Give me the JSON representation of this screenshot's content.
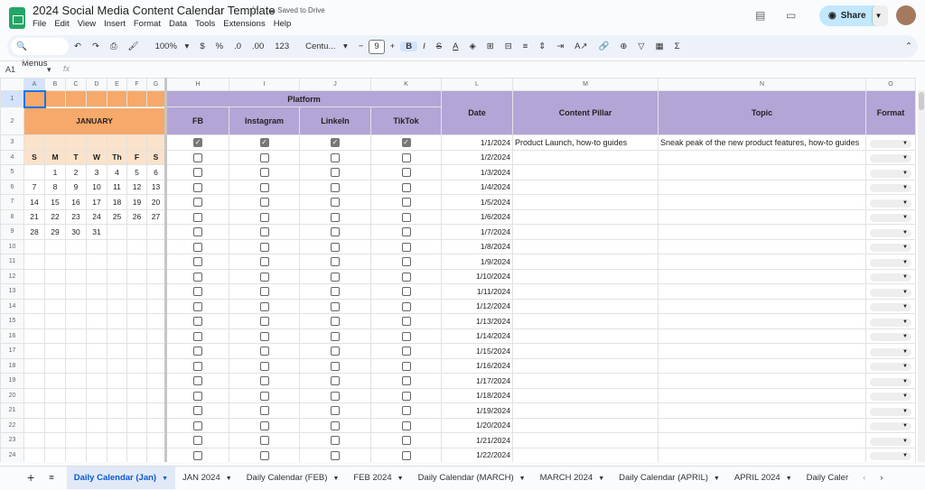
{
  "app": {
    "title": "2024 Social Media Content Calendar Template",
    "saved": "Saved to Drive",
    "share": "Share",
    "menu": [
      "File",
      "Edit",
      "View",
      "Insert",
      "Format",
      "Data",
      "Tools",
      "Extensions",
      "Help"
    ]
  },
  "toolbar": {
    "search": "Menus",
    "zoom": "100%",
    "currency": "$",
    "percent": "%",
    "dec_minus": ".0",
    "dec_plus": ".00",
    "number_format": "123",
    "font": "Centu...",
    "font_size": "9",
    "bold": "B",
    "italic": "I",
    "strike": "S",
    "sum": "Σ"
  },
  "formula_bar": {
    "cell_ref": "A1",
    "fx": "fx"
  },
  "columns": [
    "A",
    "B",
    "C",
    "D",
    "E",
    "F",
    "G",
    "H",
    "I",
    "J",
    "K",
    "L",
    "M",
    "N",
    "O"
  ],
  "calendar": {
    "month": "JANUARY",
    "weekdays": [
      "S",
      "M",
      "T",
      "W",
      "Th",
      "F",
      "S"
    ],
    "weeks": [
      [
        "",
        "1",
        "2",
        "3",
        "4",
        "5",
        "6"
      ],
      [
        "7",
        "8",
        "9",
        "10",
        "11",
        "12",
        "13"
      ],
      [
        "14",
        "15",
        "16",
        "17",
        "18",
        "19",
        "20"
      ],
      [
        "21",
        "22",
        "23",
        "24",
        "25",
        "26",
        "27"
      ],
      [
        "28",
        "29",
        "30",
        "31",
        "",
        "",
        ""
      ]
    ]
  },
  "headers": {
    "platform": "Platform",
    "fb": "FB",
    "instagram": "Instagram",
    "linkedin": "LinkeIn",
    "tiktok": "TikTok",
    "date": "Date",
    "pillar": "Content Pillar",
    "topic": "Topic",
    "format": "Format"
  },
  "rows": [
    {
      "date": "1/1/2024",
      "checked": [
        true,
        true,
        true,
        true
      ],
      "pillar": "Product Launch, how-to guides",
      "topic": "Sneak peak of the new product features, how-to guides"
    },
    {
      "date": "1/2/2024"
    },
    {
      "date": "1/3/2024"
    },
    {
      "date": "1/4/2024"
    },
    {
      "date": "1/5/2024"
    },
    {
      "date": "1/6/2024"
    },
    {
      "date": "1/7/2024"
    },
    {
      "date": "1/8/2024"
    },
    {
      "date": "1/9/2024"
    },
    {
      "date": "1/10/2024"
    },
    {
      "date": "1/11/2024"
    },
    {
      "date": "1/12/2024"
    },
    {
      "date": "1/13/2024"
    },
    {
      "date": "1/14/2024"
    },
    {
      "date": "1/15/2024"
    },
    {
      "date": "1/16/2024"
    },
    {
      "date": "1/17/2024"
    },
    {
      "date": "1/18/2024"
    },
    {
      "date": "1/19/2024"
    },
    {
      "date": "1/20/2024"
    },
    {
      "date": "1/21/2024"
    },
    {
      "date": "1/22/2024"
    }
  ],
  "sheet_tabs": [
    "Daily Calendar (Jan)",
    "JAN 2024",
    "Daily Calendar (FEB)",
    "FEB 2024",
    "Daily Calendar (MARCH)",
    "MARCH 2024",
    "Daily Calendar (APRIL)",
    "APRIL 2024",
    "Daily Caler"
  ]
}
